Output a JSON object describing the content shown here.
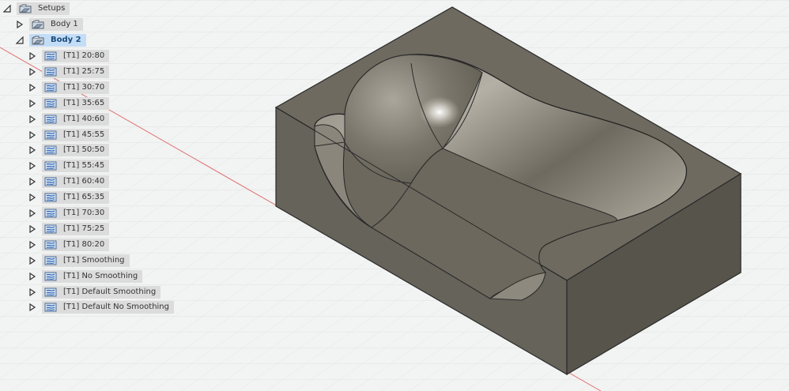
{
  "browser": {
    "setups": {
      "label": "Setups",
      "icon": "setup-folder-icon",
      "expanded": true
    },
    "bodies": [
      {
        "label": "Body 1",
        "icon": "setup-folder-icon",
        "expanded": false,
        "selected": false
      },
      {
        "label": "Body 2",
        "icon": "setup-folder-icon",
        "expanded": true,
        "selected": true
      }
    ],
    "operations": [
      {
        "label": "[T1] 20:80",
        "icon": "adaptive-toolpath-icon"
      },
      {
        "label": "[T1] 25:75",
        "icon": "adaptive-toolpath-icon"
      },
      {
        "label": "[T1] 30:70",
        "icon": "adaptive-toolpath-icon"
      },
      {
        "label": "[T1] 35:65",
        "icon": "adaptive-toolpath-icon"
      },
      {
        "label": "[T1] 40:60",
        "icon": "adaptive-toolpath-icon"
      },
      {
        "label": "[T1] 45:55",
        "icon": "adaptive-toolpath-icon"
      },
      {
        "label": "[T1] 50:50",
        "icon": "adaptive-toolpath-icon"
      },
      {
        "label": "[T1] 55:45",
        "icon": "adaptive-toolpath-icon"
      },
      {
        "label": "[T1] 60:40",
        "icon": "adaptive-toolpath-icon"
      },
      {
        "label": "[T1] 65:35",
        "icon": "adaptive-toolpath-icon"
      },
      {
        "label": "[T1] 70:30",
        "icon": "adaptive-toolpath-icon"
      },
      {
        "label": "[T1] 75:25",
        "icon": "adaptive-toolpath-icon"
      },
      {
        "label": "[T1] 80:20",
        "icon": "adaptive-toolpath-icon"
      },
      {
        "label": "[T1] Smoothing",
        "icon": "adaptive-toolpath-icon"
      },
      {
        "label": "[T1] No Smoothing",
        "icon": "adaptive-toolpath-icon"
      },
      {
        "label": "[T1] Default Smoothing",
        "icon": "adaptive-toolpath-icon"
      },
      {
        "label": "[T1] Default No Smoothing",
        "icon": "adaptive-toolpath-icon"
      }
    ]
  },
  "viewport": {
    "background": "#f2f3f3",
    "grid_color": "#d9dbdb",
    "axis_color": "#e07070",
    "model_top_color": "#6e6a60",
    "model_front_color": "#66635a",
    "model_side_color": "#57544c"
  }
}
